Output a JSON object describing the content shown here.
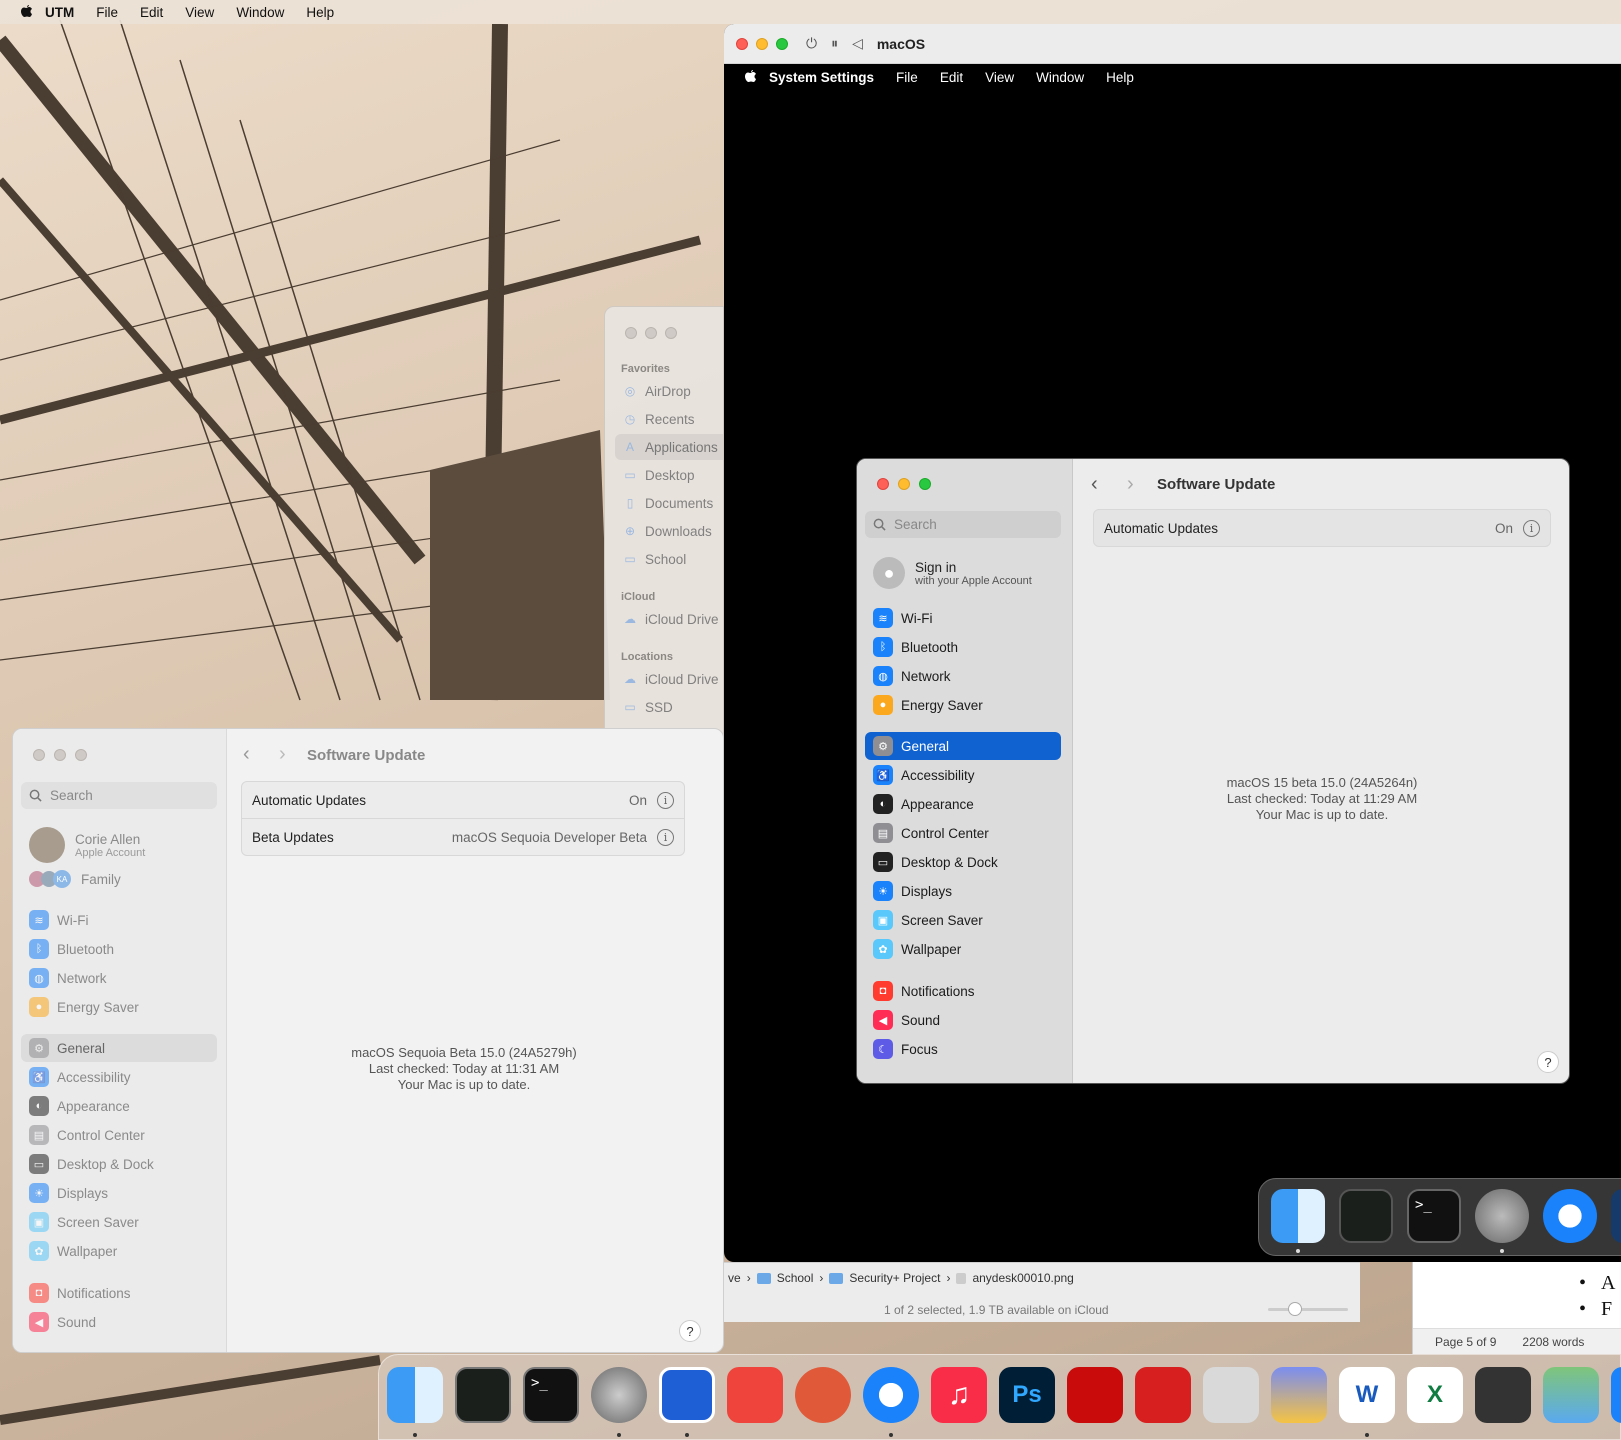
{
  "host_menubar": {
    "app_name": "UTM",
    "items": [
      "File",
      "Edit",
      "View",
      "Window",
      "Help"
    ]
  },
  "finder_sidebar": {
    "favorites_header": "Favorites",
    "favorites": [
      "AirDrop",
      "Recents",
      "Applications",
      "Desktop",
      "Documents",
      "Downloads",
      "School"
    ],
    "selected": "Applications",
    "icloud_header": "iCloud",
    "icloud": [
      "iCloud Drive"
    ],
    "locations_header": "Locations",
    "locations": [
      "iCloud Drive",
      "SSD"
    ]
  },
  "utm_window": {
    "title": "macOS",
    "guest_menubar": {
      "app_name": "System Settings",
      "items": [
        "File",
        "Edit",
        "View",
        "Window",
        "Help"
      ]
    },
    "guest_settings": {
      "search_placeholder": "Search",
      "account_title": "Sign in",
      "account_subtitle": "with your Apple Account",
      "group1": [
        "Wi-Fi",
        "Bluetooth",
        "Network",
        "Energy Saver"
      ],
      "group2": [
        "General",
        "Accessibility",
        "Appearance",
        "Control Center",
        "Desktop & Dock",
        "Displays",
        "Screen Saver",
        "Wallpaper"
      ],
      "group3": [
        "Notifications",
        "Sound",
        "Focus"
      ],
      "selected": "General",
      "page_title": "Software Update",
      "rows": [
        {
          "label": "Automatic Updates",
          "value": "On"
        }
      ],
      "status": [
        "macOS 15 beta 15.0 (24A5264n)",
        "Last checked: Today at 11:29 AM",
        "Your Mac is up to date."
      ],
      "help_label": "?"
    }
  },
  "host_settings": {
    "search_placeholder": "Search",
    "account_name": "Corie Allen",
    "account_subtitle": "Apple Account",
    "family_label": "Family",
    "family_badge": "KA",
    "group1": [
      "Wi-Fi",
      "Bluetooth",
      "Network",
      "Energy Saver"
    ],
    "group2": [
      "General",
      "Accessibility",
      "Appearance",
      "Control Center",
      "Desktop & Dock",
      "Displays",
      "Screen Saver",
      "Wallpaper"
    ],
    "group3": [
      "Notifications",
      "Sound"
    ],
    "selected": "General",
    "page_title": "Software Update",
    "rows": [
      {
        "label": "Automatic Updates",
        "value": "On"
      },
      {
        "label": "Beta Updates",
        "value": "macOS Sequoia Developer Beta"
      }
    ],
    "status": [
      "macOS Sequoia Beta 15.0 (24A5279h)",
      "Last checked: Today at 11:31 AM",
      "Your Mac is up to date."
    ],
    "help_label": "?"
  },
  "finder_bar": {
    "path": [
      "ve",
      "School",
      "Security+ Project",
      "anydesk00010.png"
    ],
    "status": "1 of 2 selected, 1.9 TB available on iCloud"
  },
  "word_doc": {
    "bullets": [
      "A",
      "F"
    ],
    "page": "Page 5 of 9",
    "words": "2208 words"
  },
  "guest_dock": [
    "finder",
    "activity-monitor",
    "terminal",
    "system-settings",
    "safari"
  ],
  "host_dock": [
    "finder",
    "activity-monitor",
    "terminal",
    "system-settings",
    "utm",
    "anydesk",
    "remote-desktop",
    "safari",
    "music",
    "photoshop",
    "acrobat",
    "pdf-app",
    "disk-utility",
    "reeder",
    "word",
    "excel",
    "calculator",
    "maps"
  ],
  "colors": {
    "accent": "#1062d0",
    "close": "#fe5f57",
    "minimize": "#febc2e",
    "zoom": "#28c840"
  }
}
